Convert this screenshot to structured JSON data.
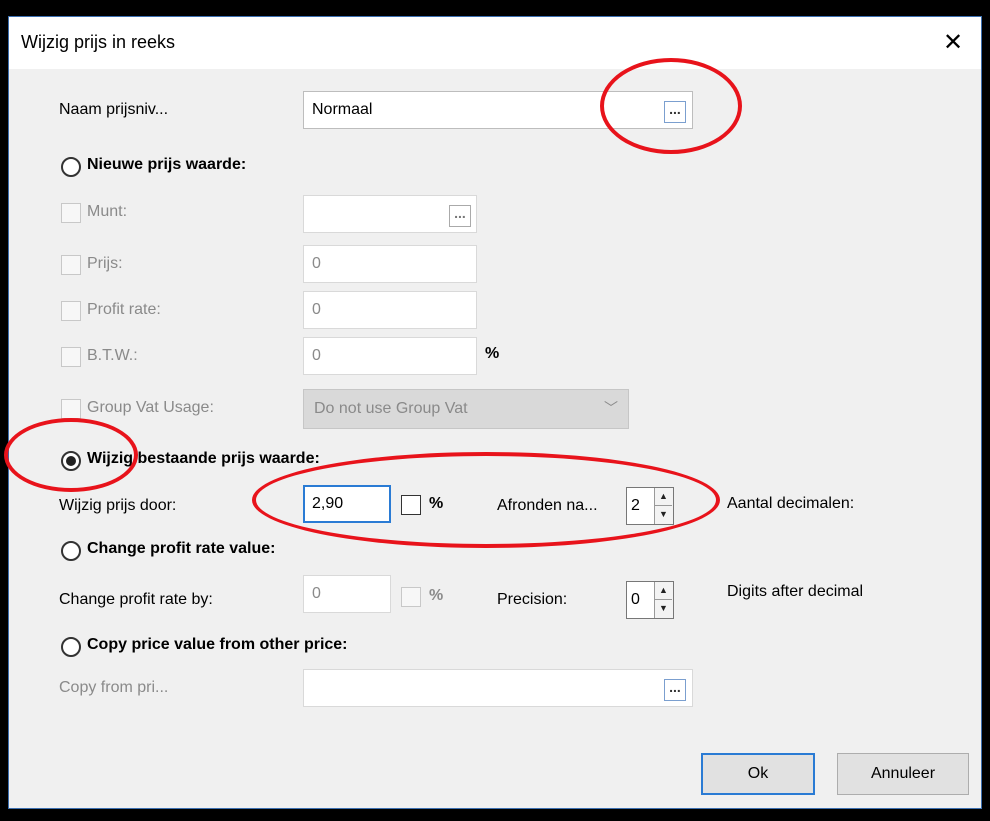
{
  "dialog": {
    "title": "Wijzig prijs in reeks",
    "close_glyph": "✕"
  },
  "price_level": {
    "label": "Naam prijsniv...",
    "value": "Normaal",
    "browse_glyph": "..."
  },
  "new_price": {
    "radio_label": "Nieuwe prijs waarde:",
    "currency_label": "Munt:",
    "currency_value": "",
    "price_label": "Prijs:",
    "price_value": "0",
    "profit_label": "Profit rate:",
    "profit_value": "0",
    "vat_label": "B.T.W.:",
    "vat_value": "0",
    "vat_unit": "%",
    "group_vat_label": "Group Vat Usage:",
    "group_vat_value": "Do not use Group Vat"
  },
  "modify_price": {
    "radio_label": "Wijzig bestaande prijs waarde:",
    "by_label": "Wijzig prijs door:",
    "by_value": "2,90",
    "percent_label": "%",
    "round_label": "Afronden na...",
    "round_value": "2",
    "decimals_label": "Aantal decimalen:"
  },
  "profit_rate": {
    "radio_label": "Change profit rate value:",
    "by_label": "Change profit rate by:",
    "by_value": "0",
    "percent_label": "%",
    "precision_label": "Precision:",
    "precision_value": "0",
    "digits_label": "Digits after decimal"
  },
  "copy_price": {
    "radio_label": "Copy price value from other price:",
    "from_label": "Copy from pri...",
    "from_value": ""
  },
  "buttons": {
    "ok": "Ok",
    "cancel": "Annuleer"
  },
  "colors": {
    "annotation": "#e8131b",
    "focus": "#2a7bd4"
  }
}
